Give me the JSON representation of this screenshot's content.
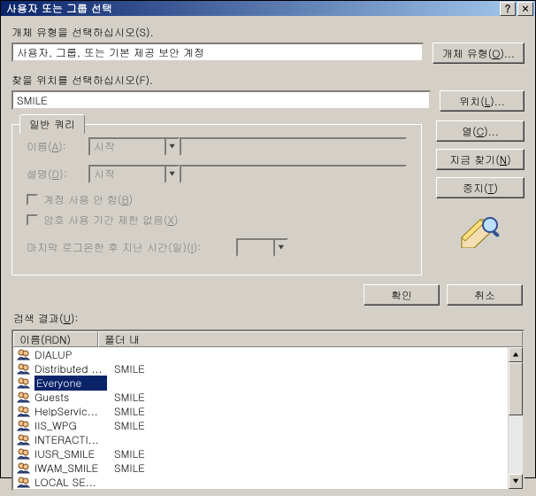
{
  "titlebar": {
    "title": "사용자 또는 그룹 선택"
  },
  "objectType": {
    "label": "개체 유형을 선택하십시오(S).",
    "value": "사용자, 그룹, 또는 기본 제공 보안 계정",
    "button": "개체 유형(O)..."
  },
  "location": {
    "label": "찾을 위치를 선택하십시오(F).",
    "value": "SMILE",
    "button": "위치(L)..."
  },
  "query": {
    "tab": "일반 쿼리",
    "nameLabel": "이름(A):",
    "descLabel": "설명(D):",
    "comboText": "시작",
    "disableAcct": "계정 사용 안 함(B)",
    "pwdNoExpire": "암호 사용 기간 제한 없음(X)",
    "lastLogin": "마지막 로그온한 후 지난 시간(일)(I):"
  },
  "rightButtons": {
    "columns": "열(C)...",
    "findNow": "지금 찾기(N)",
    "stop": "중지(T)"
  },
  "mainButtons": {
    "ok": "확인",
    "cancel": "취소"
  },
  "results": {
    "label": "검색 결과(U):",
    "columns": {
      "name": "이름(RDN)",
      "folder": "폴더 내"
    },
    "rows": [
      {
        "name": "DIALUP",
        "folder": "",
        "selected": false
      },
      {
        "name": "Distributed ...",
        "folder": "SMILE",
        "selected": false
      },
      {
        "name": "Everyone",
        "folder": "",
        "selected": true
      },
      {
        "name": "Guests",
        "folder": "SMILE",
        "selected": false
      },
      {
        "name": "HelpServic...",
        "folder": "SMILE",
        "selected": false
      },
      {
        "name": "IIS_WPG",
        "folder": "SMILE",
        "selected": false
      },
      {
        "name": "INTERACTI...",
        "folder": "",
        "selected": false
      },
      {
        "name": "IUSR_SMILE",
        "folder": "SMILE",
        "selected": false
      },
      {
        "name": "IWAM_SMILE",
        "folder": "SMILE",
        "selected": false
      },
      {
        "name": "LOCAL SE...",
        "folder": "",
        "selected": false
      }
    ]
  }
}
